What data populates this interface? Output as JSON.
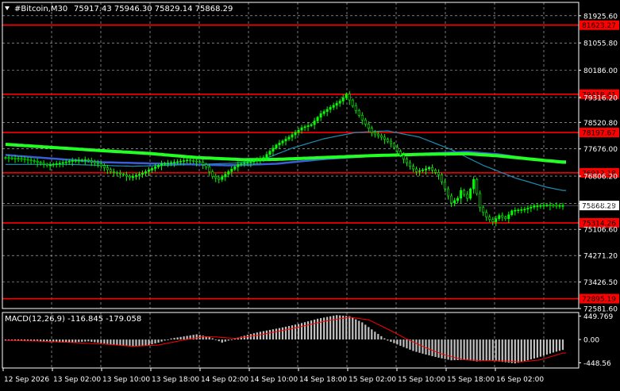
{
  "header": {
    "menu_icon": "triangle-down-icon",
    "symbol": "#Bitcoin,M30",
    "ohlc": "75917.43 75946.30 75829.14 75868.29"
  },
  "colors": {
    "background": "#000000",
    "grid": "#c8c8c8",
    "axis": "#ffffff",
    "candle": "#00ff00",
    "level_line": "#ff0000",
    "ma_fast": "#1e8fb4",
    "ma_mid": "#3a5ed8",
    "ma_slow": "#22ff22",
    "macd_hist": "#c0c0c0",
    "macd_signal": "#ff0000",
    "current_price_label_bg": "#ffffff"
  },
  "chart_data": [
    {
      "type": "candlestick",
      "ylim": [
        72581.6,
        82350
      ],
      "y_tick_labels": [
        81925.6,
        81055.8,
        80186.0,
        79316.2,
        78520.8,
        77676.0,
        76806.2,
        75936.4,
        75106.6,
        74271.2,
        73426.5,
        72581.6
      ],
      "y_tick_label_text": [
        "81925.60",
        "81055.80",
        "80186.00",
        "79316.20",
        "78520.80",
        "77676.00",
        "76806.20",
        "75936.40",
        "75106.60",
        "74271.20",
        "73426.50",
        "72581.60"
      ],
      "x_tick_labels": [
        "12 Sep 2026",
        "13 Sep 02:00",
        "13 Sep 10:00",
        "13 Sep 18:00",
        "14 Sep 02:00",
        "14 Sep 10:00",
        "14 Sep 18:00",
        "15 Sep 02:00",
        "15 Sep 10:00",
        "15 Sep 18:00",
        "16 Sep 02:00"
      ],
      "horizontal_levels": [
        {
          "value": 81623.27,
          "label": "81623.27"
        },
        {
          "value": 79418.41,
          "label": "79418.41"
        },
        {
          "value": 78197.67,
          "label": "78197.67"
        },
        {
          "value": 76912.18,
          "label": "76912.18"
        },
        {
          "value": 75314.26,
          "label": "75314.26"
        },
        {
          "value": 72895.19,
          "label": "72895.19"
        }
      ],
      "current_price": {
        "value": 75868.29,
        "label": "75868.29"
      },
      "price_path": [
        [
          0,
          77400
        ],
        [
          6,
          77360
        ],
        [
          10,
          77280
        ],
        [
          14,
          77150
        ],
        [
          18,
          77220
        ],
        [
          22,
          77300
        ],
        [
          26,
          77330
        ],
        [
          30,
          77200
        ],
        [
          34,
          76950
        ],
        [
          38,
          76850
        ],
        [
          40,
          76760
        ],
        [
          44,
          76900
        ],
        [
          47,
          77050
        ],
        [
          50,
          77200
        ],
        [
          54,
          77250
        ],
        [
          58,
          77320
        ],
        [
          62,
          77250
        ],
        [
          64,
          77100
        ],
        [
          66,
          76800
        ],
        [
          68,
          76700
        ],
        [
          71,
          76950
        ],
        [
          74,
          77180
        ],
        [
          78,
          77260
        ],
        [
          82,
          77400
        ],
        [
          86,
          77800
        ],
        [
          90,
          78050
        ],
        [
          94,
          78350
        ],
        [
          97,
          78450
        ],
        [
          100,
          78800
        ],
        [
          103,
          79000
        ],
        [
          106,
          79200
        ],
        [
          108,
          79420
        ],
        [
          110,
          79050
        ],
        [
          113,
          78600
        ],
        [
          116,
          78200
        ],
        [
          119,
          78050
        ],
        [
          122,
          77850
        ],
        [
          124,
          77600
        ],
        [
          126,
          77350
        ],
        [
          128,
          77120
        ],
        [
          130,
          76950
        ],
        [
          132,
          77000
        ],
        [
          134,
          77080
        ],
        [
          137,
          76850
        ],
        [
          139,
          76400
        ],
        [
          141,
          75950
        ],
        [
          143,
          76100
        ],
        [
          144,
          76350
        ],
        [
          146,
          76100
        ],
        [
          148,
          76700
        ],
        [
          150,
          75800
        ],
        [
          152,
          75500
        ],
        [
          154,
          75350
        ],
        [
          156,
          75550
        ],
        [
          158,
          75450
        ],
        [
          160,
          75700
        ],
        [
          164,
          75750
        ],
        [
          167,
          75850
        ],
        [
          171,
          75880
        ],
        [
          174,
          75868
        ]
      ],
      "ma_fast": [
        [
          0,
          77180
        ],
        [
          20,
          77180
        ],
        [
          40,
          77120
        ],
        [
          60,
          77180
        ],
        [
          72,
          77220
        ],
        [
          80,
          77300
        ],
        [
          90,
          77700
        ],
        [
          100,
          78000
        ],
        [
          110,
          78200
        ],
        [
          120,
          78250
        ],
        [
          130,
          78050
        ],
        [
          140,
          77650
        ],
        [
          150,
          77150
        ],
        [
          160,
          76750
        ],
        [
          170,
          76450
        ],
        [
          175,
          76350
        ]
      ],
      "ma_mid": [
        [
          0,
          77480
        ],
        [
          30,
          77250
        ],
        [
          50,
          77200
        ],
        [
          70,
          77150
        ],
        [
          85,
          77200
        ],
        [
          100,
          77350
        ],
        [
          115,
          77450
        ],
        [
          130,
          77520
        ],
        [
          145,
          77580
        ],
        [
          155,
          77500
        ],
        [
          165,
          77350
        ],
        [
          175,
          77280
        ]
      ],
      "ma_slow": [
        [
          0,
          77820
        ],
        [
          15,
          77720
        ],
        [
          30,
          77620
        ],
        [
          45,
          77530
        ],
        [
          60,
          77400
        ],
        [
          75,
          77330
        ],
        [
          85,
          77340
        ],
        [
          100,
          77400
        ],
        [
          115,
          77460
        ],
        [
          130,
          77500
        ],
        [
          145,
          77520
        ],
        [
          155,
          77450
        ],
        [
          165,
          77350
        ],
        [
          175,
          77250
        ]
      ]
    },
    {
      "type": "bar",
      "title": "MACD(12,26,9) -116.845 -179.058",
      "ylim": [
        -548,
        520
      ],
      "y_tick_labels": [
        449.769,
        0.0,
        -448.56
      ],
      "y_tick_label_text": [
        "449.769",
        "0.00",
        "-448.56"
      ],
      "histogram": [
        [
          0,
          -20
        ],
        [
          8,
          -30
        ],
        [
          14,
          -50
        ],
        [
          20,
          -60
        ],
        [
          26,
          -35
        ],
        [
          30,
          -70
        ],
        [
          36,
          -110
        ],
        [
          40,
          -140
        ],
        [
          44,
          -120
        ],
        [
          48,
          -60
        ],
        [
          52,
          20
        ],
        [
          56,
          60
        ],
        [
          60,
          100
        ],
        [
          64,
          50
        ],
        [
          68,
          -60
        ],
        [
          72,
          20
        ],
        [
          76,
          90
        ],
        [
          80,
          150
        ],
        [
          86,
          220
        ],
        [
          92,
          300
        ],
        [
          98,
          400
        ],
        [
          104,
          470
        ],
        [
          108,
          449
        ],
        [
          112,
          330
        ],
        [
          116,
          150
        ],
        [
          120,
          -20
        ],
        [
          124,
          -120
        ],
        [
          128,
          -220
        ],
        [
          132,
          -290
        ],
        [
          136,
          -350
        ],
        [
          140,
          -400
        ],
        [
          144,
          -390
        ],
        [
          148,
          -420
        ],
        [
          152,
          -400
        ],
        [
          156,
          -430
        ],
        [
          160,
          -460
        ],
        [
          164,
          -400
        ],
        [
          168,
          -330
        ],
        [
          172,
          -250
        ],
        [
          175,
          -200
        ]
      ],
      "signal": [
        [
          0,
          -15
        ],
        [
          10,
          -30
        ],
        [
          20,
          -55
        ],
        [
          30,
          -85
        ],
        [
          40,
          -130
        ],
        [
          48,
          -105
        ],
        [
          56,
          -10
        ],
        [
          62,
          55
        ],
        [
          66,
          50
        ],
        [
          72,
          20
        ],
        [
          80,
          90
        ],
        [
          90,
          210
        ],
        [
          100,
          350
        ],
        [
          108,
          430
        ],
        [
          114,
          380
        ],
        [
          120,
          200
        ],
        [
          126,
          10
        ],
        [
          132,
          -160
        ],
        [
          138,
          -300
        ],
        [
          144,
          -390
        ],
        [
          150,
          -405
        ],
        [
          156,
          -410
        ],
        [
          162,
          -430
        ],
        [
          168,
          -390
        ],
        [
          175,
          -260
        ]
      ]
    }
  ]
}
